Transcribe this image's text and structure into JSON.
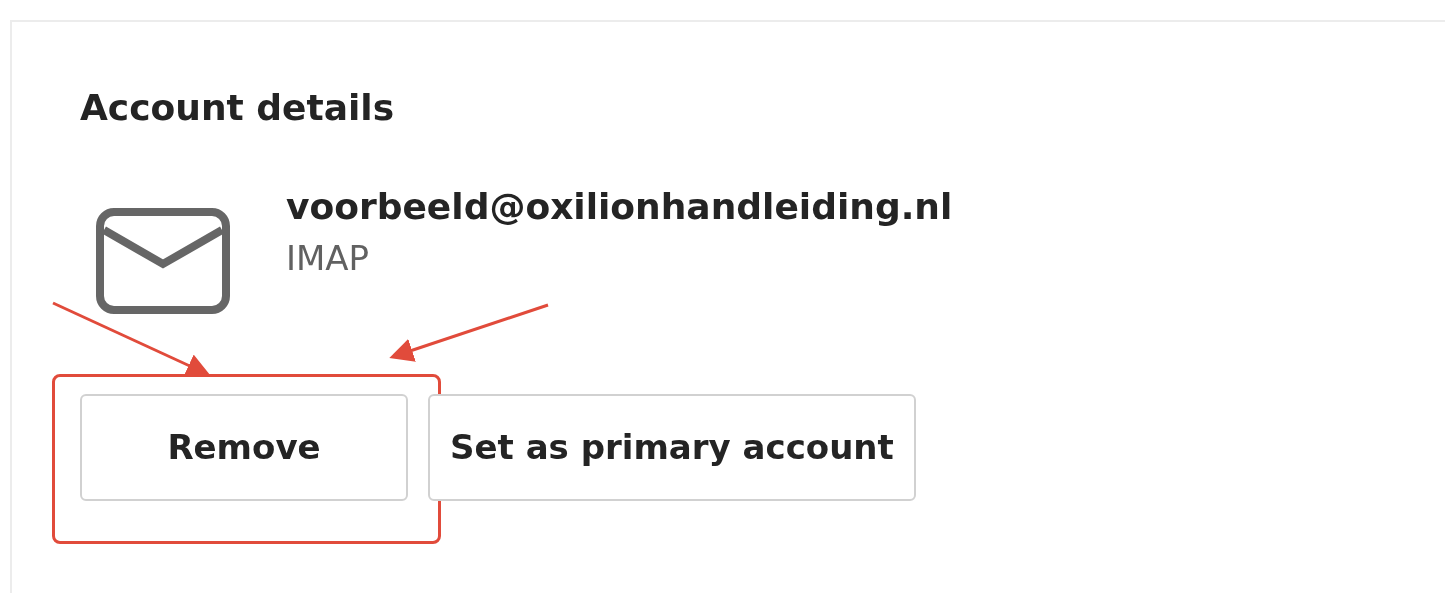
{
  "section": {
    "title": "Account details"
  },
  "account": {
    "email": "voorbeeld@oxilionhandleiding.nl",
    "type": "IMAP"
  },
  "buttons": [
    {
      "label": "Remove",
      "highlighted": true
    },
    {
      "label": "Set as primary account",
      "highlighted": false
    }
  ]
}
